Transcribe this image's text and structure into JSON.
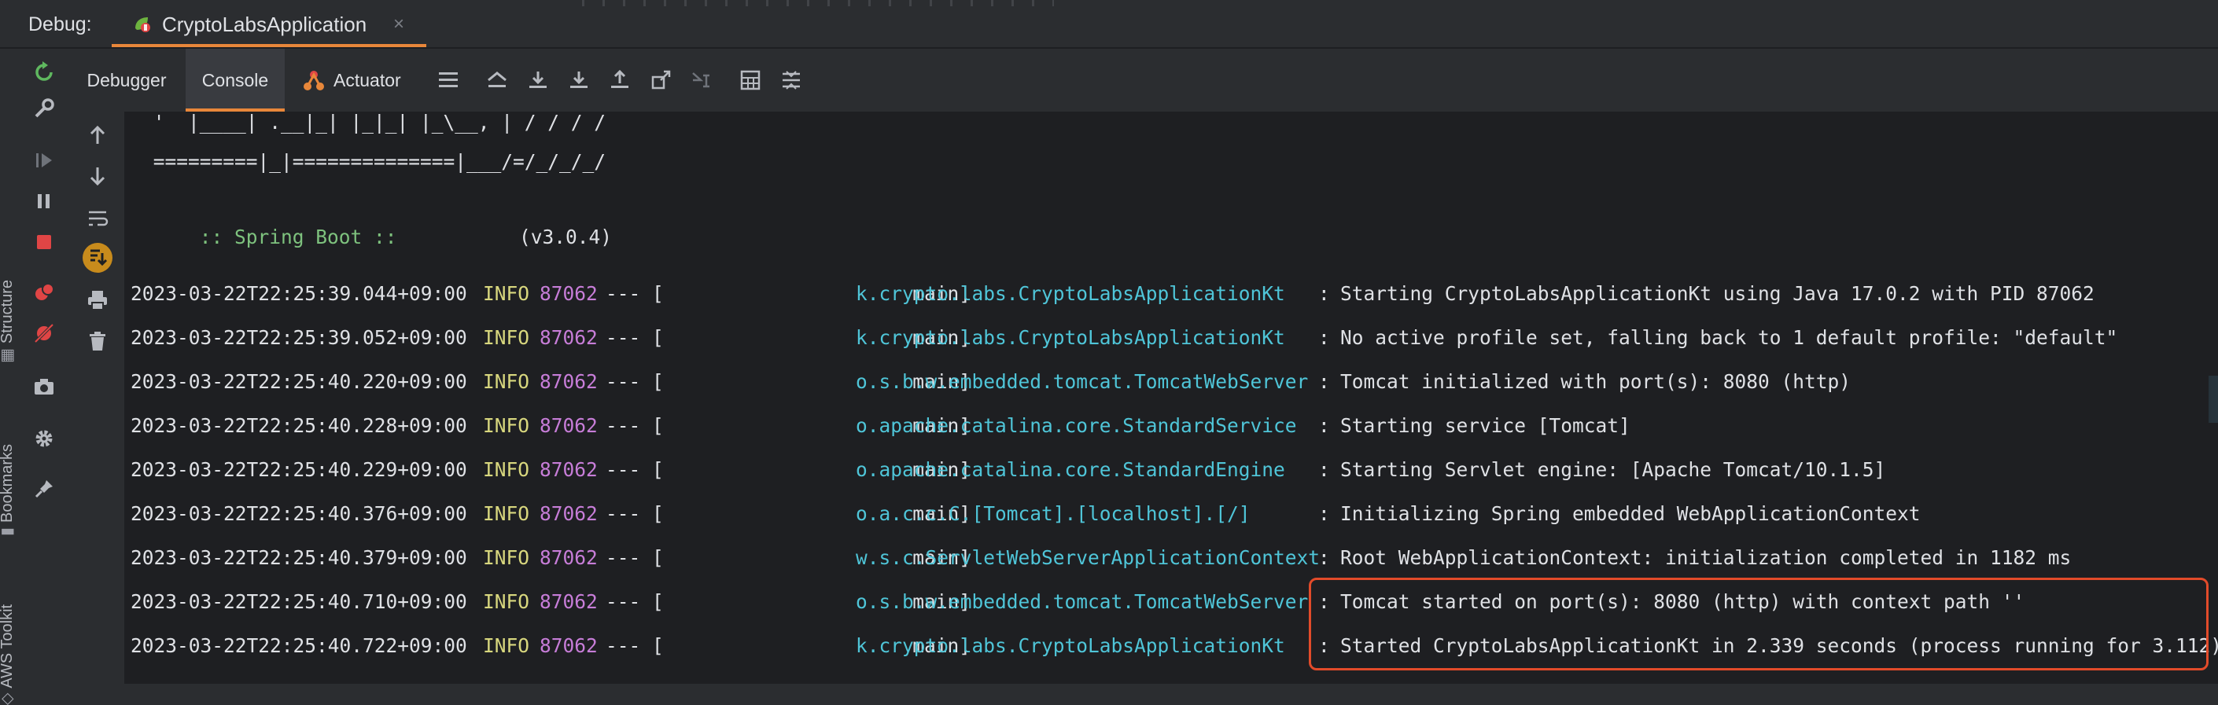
{
  "header": {
    "debug_label": "Debug:",
    "session_tab": "CryptoLabsApplication",
    "close_glyph": "×"
  },
  "side_strip": {
    "structure": "Structure",
    "bookmarks": "Bookmarks",
    "aws_toolkit": "AWS Toolkit"
  },
  "tabs": {
    "debugger": "Debugger",
    "console": "Console",
    "actuator": "Actuator"
  },
  "banner": {
    "line1": " '  |____| .__|_| |_|_| |_\\__, | / / / /",
    "line2": " =========|_|==============|___/=/_/_/_/",
    "spring_boot": " :: Spring Boot :: ",
    "version": "(v3.0.4)"
  },
  "log": [
    {
      "ts": "2023-03-22T22:25:39.044+09:00",
      "level": "INFO",
      "pid": "87062",
      "sep": "--- [",
      "thread": "main]",
      "logger": "k.crypto.labs.CryptoLabsApplicationKt",
      "colon": ":",
      "msg": "Starting CryptoLabsApplicationKt using Java 17.0.2 with PID 87062"
    },
    {
      "ts": "2023-03-22T22:25:39.052+09:00",
      "level": "INFO",
      "pid": "87062",
      "sep": "--- [",
      "thread": "main]",
      "logger": "k.crypto.labs.CryptoLabsApplicationKt",
      "colon": ":",
      "msg": "No active profile set, falling back to 1 default profile: \"default\""
    },
    {
      "ts": "2023-03-22T22:25:40.220+09:00",
      "level": "INFO",
      "pid": "87062",
      "sep": "--- [",
      "thread": "main]",
      "logger": "o.s.b.w.embedded.tomcat.TomcatWebServer",
      "colon": ":",
      "msg": "Tomcat initialized with port(s): 8080 (http)"
    },
    {
      "ts": "2023-03-22T22:25:40.228+09:00",
      "level": "INFO",
      "pid": "87062",
      "sep": "--- [",
      "thread": "main]",
      "logger": "o.apache.catalina.core.StandardService",
      "colon": ":",
      "msg": "Starting service [Tomcat]"
    },
    {
      "ts": "2023-03-22T22:25:40.229+09:00",
      "level": "INFO",
      "pid": "87062",
      "sep": "--- [",
      "thread": "main]",
      "logger": "o.apache.catalina.core.StandardEngine",
      "colon": ":",
      "msg": "Starting Servlet engine: [Apache Tomcat/10.1.5]"
    },
    {
      "ts": "2023-03-22T22:25:40.376+09:00",
      "level": "INFO",
      "pid": "87062",
      "sep": "--- [",
      "thread": "main]",
      "logger": "o.a.c.c.C.[Tomcat].[localhost].[/]",
      "colon": ":",
      "msg": "Initializing Spring embedded WebApplicationContext"
    },
    {
      "ts": "2023-03-22T22:25:40.379+09:00",
      "level": "INFO",
      "pid": "87062",
      "sep": "--- [",
      "thread": "main]",
      "logger": "w.s.c.ServletWebServerApplicationContext",
      "colon": ":",
      "msg": "Root WebApplicationContext: initialization completed in 1182 ms"
    },
    {
      "ts": "2023-03-22T22:25:40.710+09:00",
      "level": "INFO",
      "pid": "87062",
      "sep": "--- [",
      "thread": "main]",
      "logger": "o.s.b.w.embedded.tomcat.TomcatWebServer",
      "colon": ":",
      "msg": "Tomcat started on port(s): 8080 (http) with context path ''"
    },
    {
      "ts": "2023-03-22T22:25:40.722+09:00",
      "level": "INFO",
      "pid": "87062",
      "sep": "--- [",
      "thread": "main]",
      "logger": "k.crypto.labs.CryptoLabsApplicationKt",
      "colon": ":",
      "msg": "Started CryptoLabsApplicationKt in 2.339 seconds (process running for 3.112)"
    }
  ],
  "colors": {
    "accent": "#e8873a",
    "highlight": "#e24b2a",
    "logger": "#4fc5d8",
    "level": "#d8d77e",
    "pid": "#c77dd8",
    "banner_green": "#7ec27e"
  }
}
